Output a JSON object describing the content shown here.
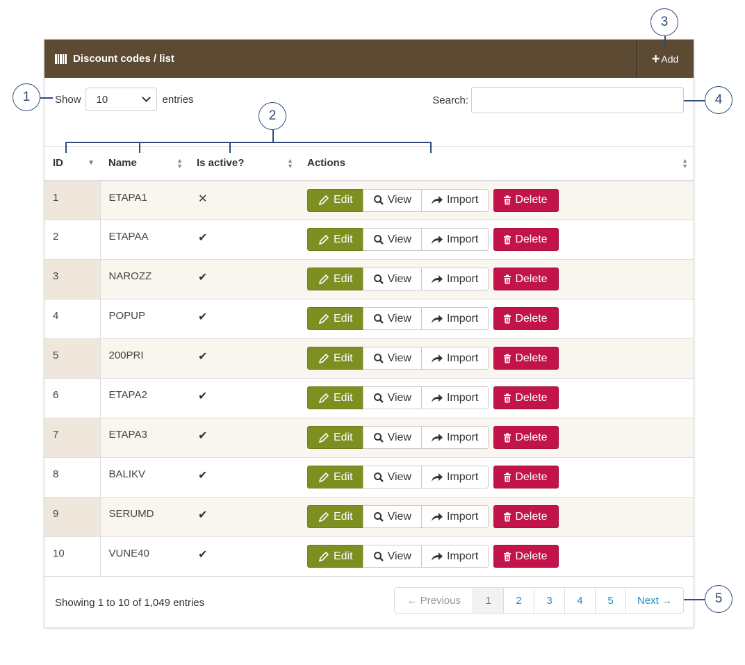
{
  "header": {
    "title": "Discount codes / list",
    "add_label": "Add"
  },
  "length": {
    "show_label": "Show",
    "value": "10",
    "entries_label": "entries"
  },
  "search": {
    "label": "Search:",
    "value": ""
  },
  "columns": [
    "ID",
    "Name",
    "Is active?",
    "Actions"
  ],
  "actions": {
    "edit": "Edit",
    "view": "View",
    "import": "Import",
    "delete": "Delete"
  },
  "rows": [
    {
      "id": "1",
      "name": "ETAPA1",
      "active": "✕"
    },
    {
      "id": "2",
      "name": "ETAPAA",
      "active": "✔"
    },
    {
      "id": "3",
      "name": "NAROZZ",
      "active": "✔"
    },
    {
      "id": "4",
      "name": "POPUP",
      "active": "✔"
    },
    {
      "id": "5",
      "name": "200PRI",
      "active": "✔"
    },
    {
      "id": "6",
      "name": "ETAPA2",
      "active": "✔"
    },
    {
      "id": "7",
      "name": "ETAPA3",
      "active": "✔"
    },
    {
      "id": "8",
      "name": "BALIKV",
      "active": "✔"
    },
    {
      "id": "9",
      "name": "SERUMD",
      "active": "✔"
    },
    {
      "id": "10",
      "name": "VUNE40",
      "active": "✔"
    }
  ],
  "footer": {
    "info": "Showing 1 to 10 of 1,049 entries",
    "prev": "← Previous",
    "pages": [
      "1",
      "2",
      "3",
      "4",
      "5"
    ],
    "next": "Next →"
  },
  "callouts": [
    "1",
    "2",
    "3",
    "4",
    "5"
  ],
  "colors": {
    "header": "#5c4a33",
    "edit": "#7d8f20",
    "delete": "#c2144b",
    "link": "#1a8fc7",
    "callout": "#2e4b7c"
  }
}
